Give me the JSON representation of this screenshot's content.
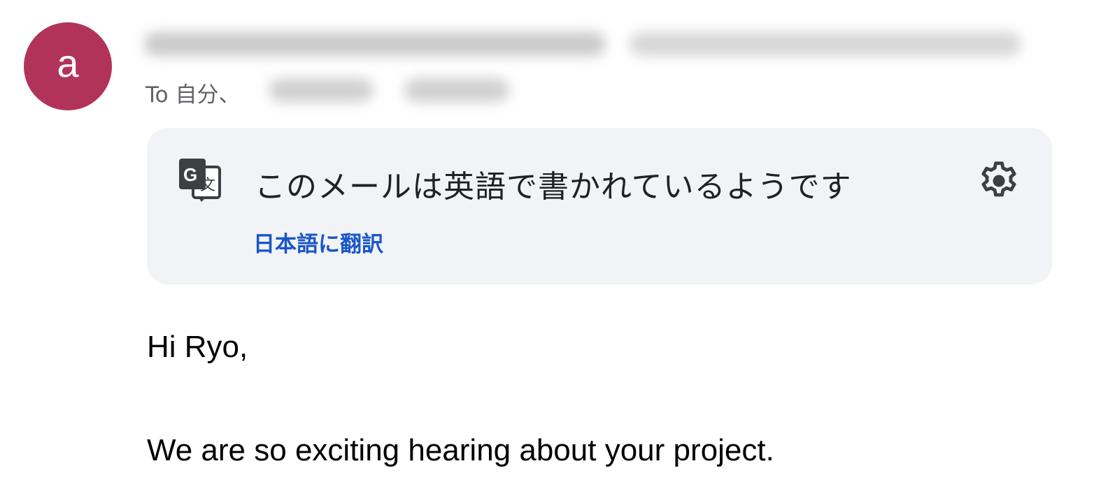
{
  "colors": {
    "avatar_bg": "#b2335a",
    "link": "#1a56c8",
    "card_bg": "#f1f3f6"
  },
  "sender": {
    "avatar_letter": "a"
  },
  "recipients": {
    "to_label": "To 自分、"
  },
  "translate_banner": {
    "icon": "google-translate-icon",
    "message": "このメールは英語で書かれているようです",
    "translate_link": "日本語に翻訳",
    "settings_icon": "gear-icon"
  },
  "email_body": {
    "greeting": "Hi Ryo,",
    "line1": "We are so exciting hearing about your project."
  }
}
